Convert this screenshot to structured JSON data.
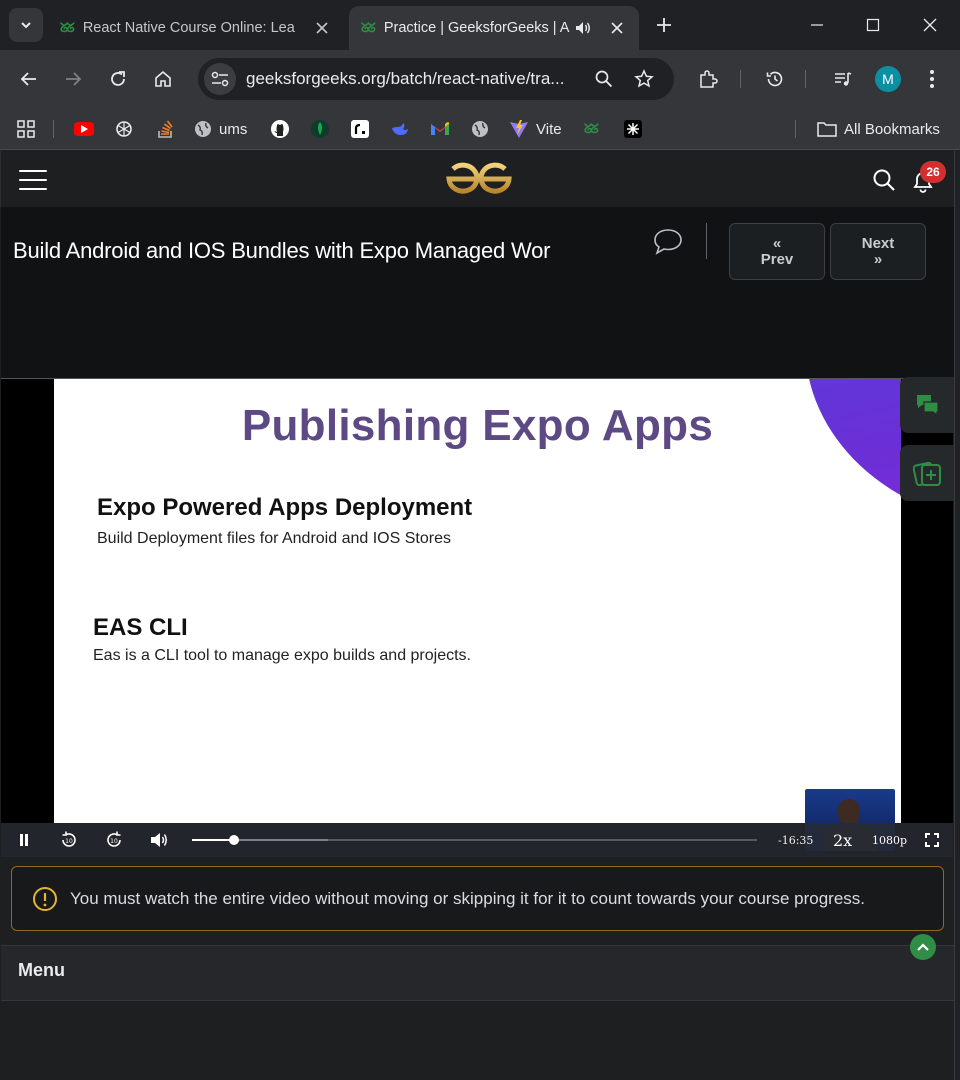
{
  "browser": {
    "tabs": [
      {
        "title": "React Native Course Online: Lea",
        "active": false
      },
      {
        "title": "Practice | GeeksforGeeks | A",
        "active": true
      }
    ],
    "favicon_text": "ᘜᘜ",
    "url": "geeksforgeeks.org/batch/react-native/tra...",
    "profile_initial": "M",
    "bookmarks": [
      {
        "label": "ums"
      },
      {
        "label": "Vite"
      }
    ],
    "all_bookmarks_label": "All Bookmarks"
  },
  "header": {
    "notification_count": "26"
  },
  "lesson": {
    "title": "Build Android and IOS Bundles with Expo Managed Wor",
    "prev_label": "Prev",
    "next_label": "Next",
    "prev_chevron": "«",
    "next_chevron": "»"
  },
  "video": {
    "slide_title": "Publishing Expo Apps",
    "section1_heading": "Expo Powered Apps Deployment",
    "section1_text": "Build Deployment files for Android and IOS Stores",
    "section2_heading": "EAS CLI",
    "section2_text": "Eas is a CLI tool to manage expo builds and projects.",
    "time_remaining": "-16:35",
    "speed": "2x",
    "quality": "1080p",
    "progress": 0.074,
    "buffered": 0.24
  },
  "notice": {
    "text": "You must watch the entire video without moving or skipping it for it to count towards your course progress."
  },
  "menu": {
    "label": "Menu"
  },
  "colors": {
    "accent_green": "#2f8d46",
    "badge_red": "#d32f2f",
    "slide_title": "#5d4a84",
    "notice_border": "#8a6d1c"
  }
}
